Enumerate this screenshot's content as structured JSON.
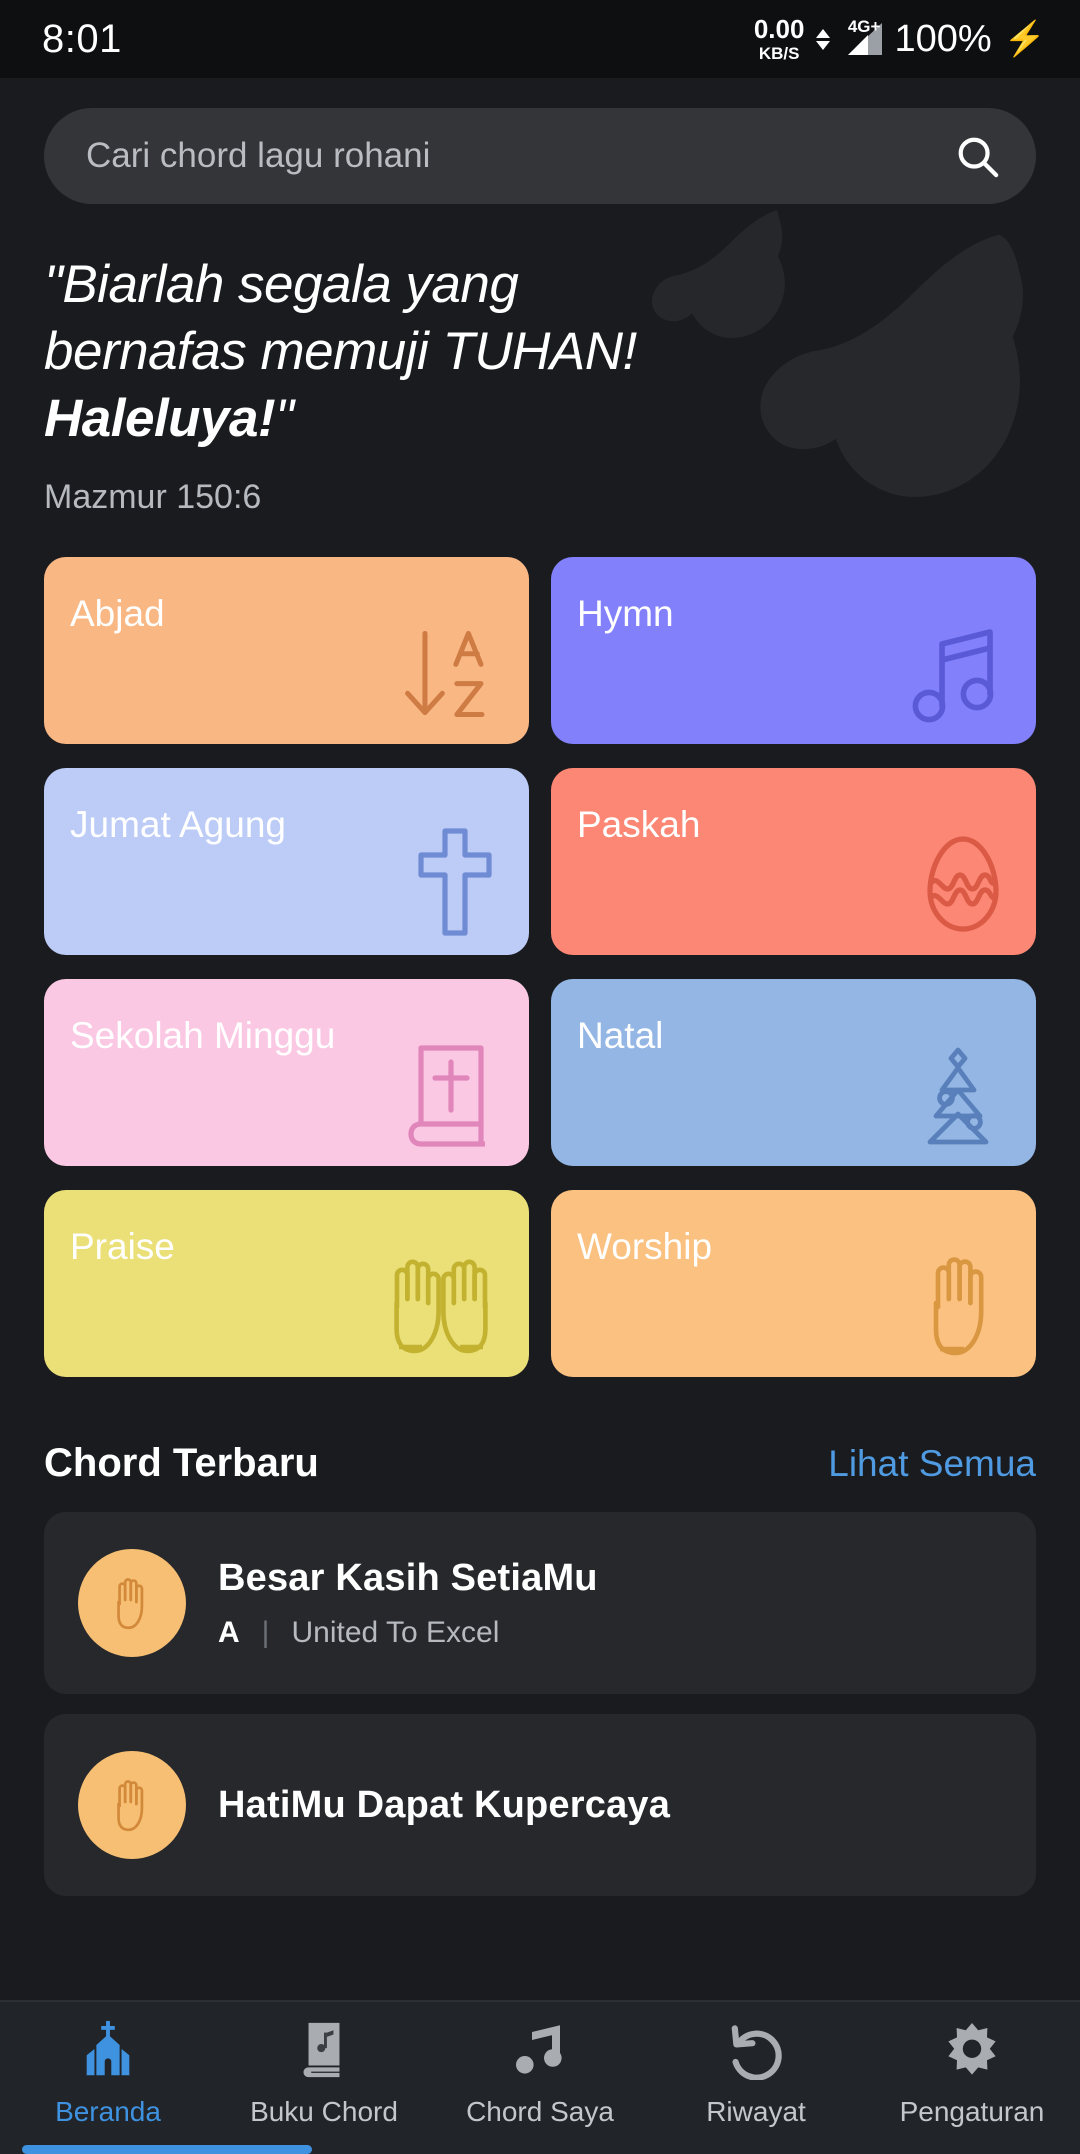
{
  "status_bar": {
    "time": "8:01",
    "net_speed": "0.00",
    "net_unit": "KB/S",
    "network_type": "4G+",
    "battery": "100%",
    "charging_icon": "bolt-icon"
  },
  "search": {
    "placeholder": "Cari chord lagu rohani",
    "value": "",
    "icon": "search-icon"
  },
  "hero": {
    "quote_line1": "\"Biarlah segala yang",
    "quote_line2": "bernafas memuji TUHAN!",
    "quote_emphasis": "Haleluya!",
    "quote_close": "\"",
    "verse_reference": "Mazmur 150:6"
  },
  "categories": [
    {
      "label": "Abjad",
      "bg": "#f9b784",
      "icon": "sort-alpha-down-icon",
      "icon_color": "#cf7b44"
    },
    {
      "label": "Hymn",
      "bg": "#8281fb",
      "icon": "music-note-beamed-icon",
      "icon_color": "#5a59d6"
    },
    {
      "label": "Jumat Agung",
      "bg": "#bcccf7",
      "icon": "cross-icon",
      "icon_color": "#6f8bd4"
    },
    {
      "label": "Paskah",
      "bg": "#fb8774",
      "icon": "easter-egg-icon",
      "icon_color": "#da5a45"
    },
    {
      "label": "Sekolah Minggu",
      "bg": "#fbc8e4",
      "icon": "bible-book-icon",
      "icon_color": "#e086bb"
    },
    {
      "label": "Natal",
      "bg": "#93b6e4",
      "icon": "christmas-tree-icon",
      "icon_color": "#5980bb"
    },
    {
      "label": "Praise",
      "bg": "#ebdf78",
      "icon": "raised-hands-icon",
      "icon_color": "#c2b22f"
    },
    {
      "label": "Worship",
      "bg": "#fbc180",
      "icon": "praying-hand-icon",
      "icon_color": "#d99741"
    }
  ],
  "recent_section": {
    "title": "Chord Terbaru",
    "see_all": "Lihat Semua"
  },
  "songs": [
    {
      "title": "Besar Kasih SetiaMu",
      "key": "A",
      "separator": "|",
      "artist": "United To Excel",
      "avatar_icon": "raised-hand-icon"
    },
    {
      "title": "HatiMu Dapat Kupercaya",
      "key": "",
      "separator": "",
      "artist": "",
      "avatar_icon": "raised-hand-icon"
    }
  ],
  "bottom_nav": {
    "active_index": 0,
    "items": [
      {
        "label": "Beranda",
        "icon": "church-icon"
      },
      {
        "label": "Buku Chord",
        "icon": "book-music-icon"
      },
      {
        "label": "Chord Saya",
        "icon": "music-note-icon"
      },
      {
        "label": "Riwayat",
        "icon": "history-undo-icon"
      },
      {
        "label": "Pengaturan",
        "icon": "gear-icon"
      }
    ]
  },
  "colors": {
    "background": "#191b1f",
    "accent_blue": "#3e92e0",
    "card": "#26282c",
    "search_field": "#333538"
  }
}
